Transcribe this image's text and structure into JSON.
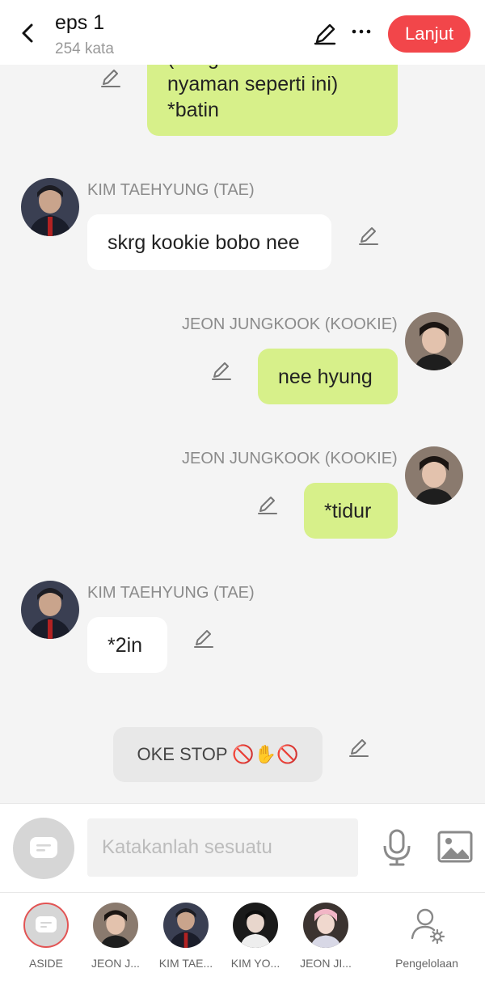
{
  "header": {
    "title": "eps 1",
    "word_count": "254 kata",
    "next_label": "Lanjut",
    "accent_color": "#f2464a"
  },
  "messages": [
    {
      "side": "right",
      "text": "(hangat Kookie\nnyaman seperti ini)\n*batin"
    },
    {
      "side": "left",
      "speaker": "KIM TAEHYUNG (TAE)",
      "text": "skrg kookie bobo nee"
    },
    {
      "side": "right",
      "speaker": "JEON JUNGKOOK (KOOKIE)",
      "text": "nee hyung"
    },
    {
      "side": "right",
      "speaker": "JEON JUNGKOOK (KOOKIE)",
      "text": "*tidur"
    },
    {
      "side": "left",
      "speaker": "KIM TAEHYUNG (TAE)",
      "text": "*2in"
    },
    {
      "side": "center",
      "text": "OKE STOP 🚫✋🚫"
    }
  ],
  "composer": {
    "placeholder": "Katakanlah sesuatu",
    "icons": [
      "aside-icon",
      "microphone-icon",
      "image-icon"
    ]
  },
  "characters": [
    {
      "label": "ASIDE",
      "selected": true
    },
    {
      "label": "JEON J..."
    },
    {
      "label": "KIM TAE..."
    },
    {
      "label": "KIM YO..."
    },
    {
      "label": "JEON JI..."
    },
    {
      "label": "Pengelolaan"
    }
  ],
  "colors": {
    "right_bubble": "#d7f08a",
    "left_bubble": "#ffffff",
    "narration_bubble": "#e8e8e8",
    "background": "#f4f4f4"
  }
}
